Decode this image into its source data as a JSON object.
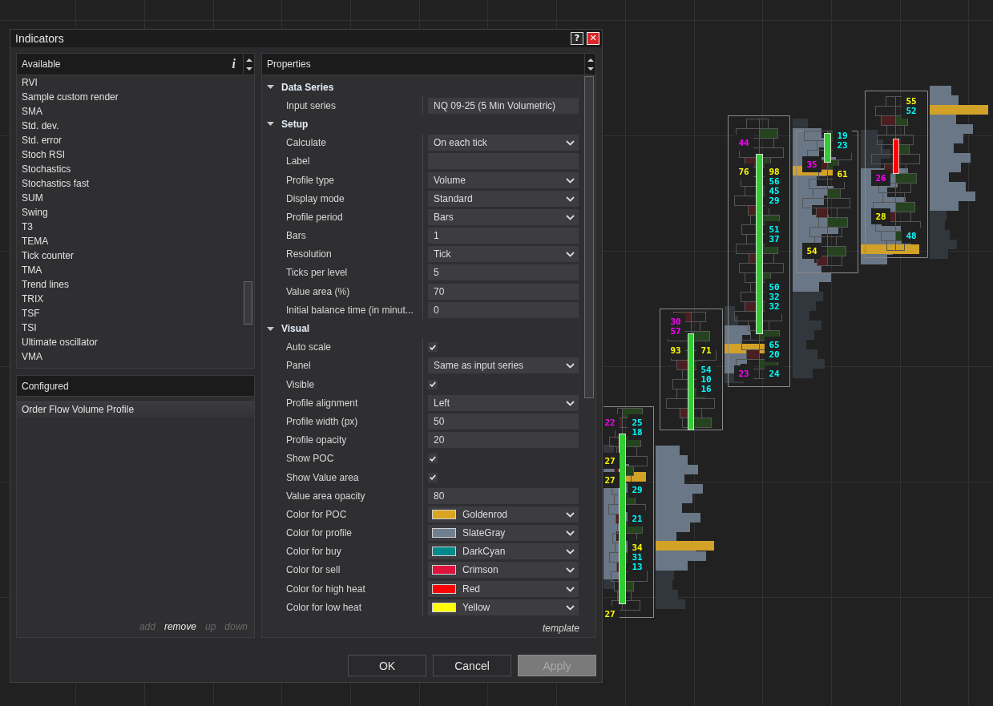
{
  "window": {
    "title": "Indicators",
    "buttons": [
      {
        "kind": "help",
        "label": "?"
      },
      {
        "kind": "close",
        "label": "✕"
      }
    ]
  },
  "available": {
    "title": "Available",
    "info": "i",
    "items": [
      {
        "label": "RVI",
        "selected": false
      },
      {
        "label": "Sample custom render",
        "selected": false
      },
      {
        "label": "SMA",
        "selected": false
      },
      {
        "label": "Std. dev.",
        "selected": false
      },
      {
        "label": "Std. error",
        "selected": false
      },
      {
        "label": "Stoch RSI",
        "selected": false
      },
      {
        "label": "Stochastics",
        "selected": false
      },
      {
        "label": "Stochastics fast",
        "selected": false
      },
      {
        "label": "SUM",
        "selected": false
      },
      {
        "label": "Swing",
        "selected": false
      },
      {
        "label": "T3",
        "selected": false
      },
      {
        "label": "TEMA",
        "selected": false
      },
      {
        "label": "Tick counter",
        "selected": false
      },
      {
        "label": "TMA",
        "selected": false
      },
      {
        "label": "Trend lines",
        "selected": false
      },
      {
        "label": "TRIX",
        "selected": false
      },
      {
        "label": "TSF",
        "selected": false
      },
      {
        "label": "TSI",
        "selected": false
      },
      {
        "label": "Ultimate oscillator",
        "selected": false
      },
      {
        "label": "VMA",
        "selected": false
      }
    ]
  },
  "configured": {
    "title": "Configured",
    "items": [
      {
        "label": "Order Flow Volume Profile",
        "selected": true
      }
    ],
    "actions": [
      {
        "label": "add",
        "disabled": true
      },
      {
        "label": "remove",
        "disabled": false
      },
      {
        "label": "up",
        "disabled": true
      },
      {
        "label": "down",
        "disabled": true
      }
    ]
  },
  "properties": {
    "title": "Properties",
    "groups": [
      {
        "name": "Data Series",
        "expanded": true,
        "rows": [
          {
            "label": "Input series",
            "kind": "text",
            "value": "NQ 09-25 (5 Min Volumetric)"
          }
        ]
      },
      {
        "name": "Setup",
        "expanded": true,
        "rows": [
          {
            "label": "Calculate",
            "kind": "dropdown",
            "value": "On each tick"
          },
          {
            "label": "Label",
            "kind": "text"
          },
          {
            "label": "Profile type",
            "kind": "dropdown",
            "value": "Volume"
          },
          {
            "label": "Display mode",
            "kind": "dropdown",
            "value": "Standard"
          },
          {
            "label": "Profile period",
            "kind": "dropdown",
            "value": "Bars"
          },
          {
            "label": "Bars",
            "kind": "text",
            "value": "1"
          },
          {
            "label": "Resolution",
            "kind": "dropdown",
            "value": "Tick"
          },
          {
            "label": "Ticks per level",
            "kind": "text",
            "value": "5"
          },
          {
            "label": "Value area (%)",
            "kind": "text",
            "value": "70"
          },
          {
            "label": "Initial balance time (in minut...",
            "kind": "text",
            "value": "0"
          }
        ]
      },
      {
        "name": "Visual",
        "expanded": true,
        "rows": [
          {
            "label": "Auto scale",
            "kind": "checkbox",
            "checked": true
          },
          {
            "label": "Panel",
            "kind": "dropdown",
            "value": "Same as input series"
          },
          {
            "label": "Visible",
            "kind": "checkbox",
            "checked": true
          },
          {
            "label": "Profile alignment",
            "kind": "dropdown",
            "value": "Left"
          },
          {
            "label": "Profile width (px)",
            "kind": "text",
            "value": "50"
          },
          {
            "label": "Profile opacity",
            "kind": "text",
            "value": "20"
          },
          {
            "label": "Show POC",
            "kind": "checkbox",
            "checked": true
          },
          {
            "label": "Show Value area",
            "kind": "checkbox",
            "checked": true
          },
          {
            "label": "Value area opacity",
            "kind": "text",
            "value": "80"
          },
          {
            "label": "Color for POC",
            "kind": "color",
            "value": "Goldenrod",
            "color": "#daa520"
          },
          {
            "label": "Color for profile",
            "kind": "color",
            "value": "SlateGray",
            "color": "#708090"
          },
          {
            "label": "Color for buy",
            "kind": "color",
            "value": "DarkCyan",
            "color": "#008b8b"
          },
          {
            "label": "Color for sell",
            "kind": "color",
            "value": "Crimson",
            "color": "#dc143c"
          },
          {
            "label": "Color for high heat",
            "kind": "color",
            "value": "Red",
            "color": "#ff0000"
          },
          {
            "label": "Color for low heat",
            "kind": "color",
            "value": "Yellow",
            "color": "#ffff00"
          }
        ]
      }
    ],
    "template_link": "template"
  },
  "buttons": [
    {
      "label": "OK",
      "disabled": false
    },
    {
      "label": "Cancel",
      "disabled": false
    },
    {
      "label": "Apply",
      "disabled": true
    }
  ],
  "chart": {
    "bars": [
      {
        "color": "#32cd32",
        "labels": [
          {
            "text": "22",
            "color": "#ff00ff"
          },
          {
            "text": "25",
            "color": "#00ffff"
          },
          {
            "text": "18",
            "color": "#00ffff"
          },
          {
            "text": "27",
            "color": "#ffff00"
          },
          {
            "text": "27",
            "color": "#ffff00"
          },
          {
            "text": "29",
            "color": "#00ffff"
          },
          {
            "text": "21",
            "color": "#00ffff"
          },
          {
            "text": "34",
            "color": "#ffff00"
          },
          {
            "text": "31",
            "color": "#00ffff"
          },
          {
            "text": "13",
            "color": "#00ffff"
          },
          {
            "text": "27",
            "color": "#ffff00"
          }
        ]
      },
      {
        "color": "#32cd32",
        "labels": [
          {
            "text": "30",
            "color": "#ff00ff"
          },
          {
            "text": "57",
            "color": "#ff00ff"
          },
          {
            "text": "93",
            "color": "#ffff00"
          },
          {
            "text": "71",
            "color": "#ffff00"
          },
          {
            "text": "54",
            "color": "#00ffff"
          },
          {
            "text": "10",
            "color": "#00ffff"
          },
          {
            "text": "16",
            "color": "#00ffff"
          }
        ]
      },
      {
        "color": "#32cd32",
        "labels": [
          {
            "text": "44",
            "color": "#ff00ff"
          },
          {
            "text": "76",
            "color": "#ffff00"
          },
          {
            "text": "98",
            "color": "#ffff00"
          },
          {
            "text": "56",
            "color": "#00ffff"
          },
          {
            "text": "45",
            "color": "#00ffff"
          },
          {
            "text": "29",
            "color": "#00ffff"
          },
          {
            "text": "51",
            "color": "#00ffff"
          },
          {
            "text": "37",
            "color": "#00ffff"
          },
          {
            "text": "50",
            "color": "#00ffff"
          },
          {
            "text": "32",
            "color": "#00ffff"
          },
          {
            "text": "32",
            "color": "#00ffff"
          },
          {
            "text": "65",
            "color": "#00ffff"
          },
          {
            "text": "20",
            "color": "#00ffff"
          },
          {
            "text": "23",
            "color": "#ff00ff"
          },
          {
            "text": "24",
            "color": "#00ffff"
          }
        ]
      },
      {
        "color": "#32cd32",
        "labels": [
          {
            "text": "19",
            "color": "#00ffff"
          },
          {
            "text": "23",
            "color": "#00ffff"
          },
          {
            "text": "35",
            "color": "#ff00ff"
          },
          {
            "text": "61",
            "color": "#ffff00"
          },
          {
            "text": "54",
            "color": "#ffff00"
          }
        ]
      },
      {
        "color": "#ff0000",
        "labels": [
          {
            "text": "55",
            "color": "#ffff00"
          },
          {
            "text": "52",
            "color": "#00ffff"
          },
          {
            "text": "26",
            "color": "#ff00ff"
          },
          {
            "text": "28",
            "color": "#ffff00"
          },
          {
            "text": "48",
            "color": "#00ffff"
          }
        ]
      }
    ]
  }
}
